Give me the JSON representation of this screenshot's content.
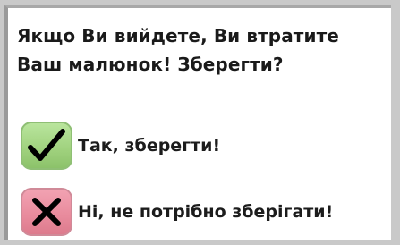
{
  "dialog": {
    "message": "Якщо Ви вийдете, Ви втратите\nВаш малюнок! Зберегти?",
    "options": [
      {
        "label": "Так, зберегти!",
        "icon": "checkmark-icon",
        "color": "#a6d784"
      },
      {
        "label": "Ні, не потрібно зберігати!",
        "icon": "cross-icon",
        "color": "#e98c9d"
      }
    ]
  }
}
